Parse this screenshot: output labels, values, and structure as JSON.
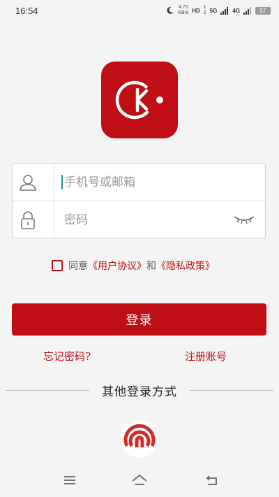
{
  "status_bar": {
    "time": "16:54",
    "speed_value": "4.70",
    "speed_unit": "KB/s",
    "hd": "HD",
    "sim1": "1",
    "sim2": "2",
    "network_5g": "5G",
    "network_4g": "4G",
    "battery": "57"
  },
  "colors": {
    "brand": "#bf0f14",
    "background": "#f4f4f4",
    "cursor": "#1a9a8a"
  },
  "login_form": {
    "phone_placeholder": "手机号或邮箱",
    "password_placeholder": "密码"
  },
  "agreement": {
    "prefix": "同意",
    "user_agreement": "《用户协议》",
    "and": "和",
    "privacy_policy": "《隐私政策》"
  },
  "login_button": "登录",
  "forgot_password": "忘记密码?",
  "register": "注册账号",
  "other_login_title": "其他登录方式",
  "icons": {
    "logo": "app-logo-icon",
    "user": "user-icon",
    "lock": "lock-icon",
    "eye": "eye-closed-icon",
    "quick_login": "signal-login-icon",
    "menu": "menu-icon",
    "home": "home-icon",
    "back": "back-icon"
  }
}
